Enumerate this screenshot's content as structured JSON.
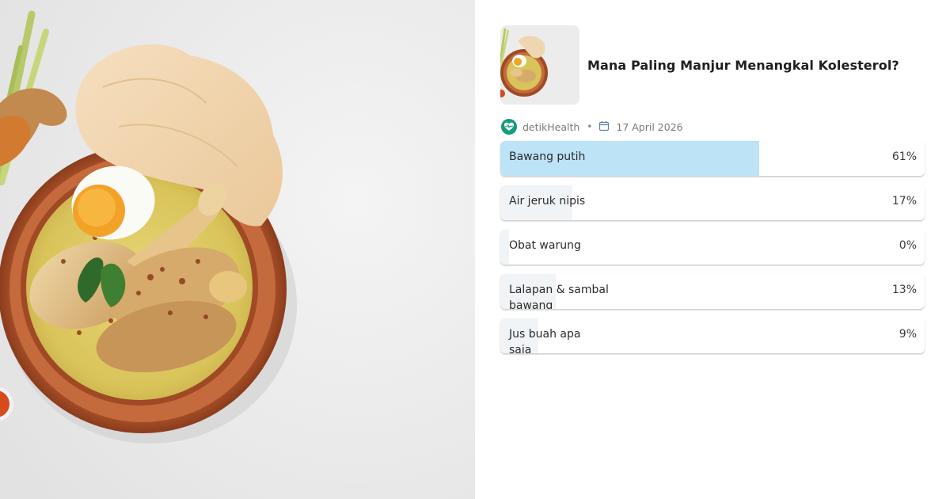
{
  "poll": {
    "title": "Mana Paling Manjur Menangkal Kolesterol?",
    "source": "detikHealth",
    "date": "17 April 2026",
    "icons": {
      "source_logo": "heart-pulse-icon",
      "date": "calendar-icon"
    },
    "accent_color": "#bde3f6",
    "options": [
      {
        "label": "Bawang putih",
        "percent_label": "61%",
        "percent": 61
      },
      {
        "label": "Air jeruk nipis",
        "percent_label": "17%",
        "percent": 17
      },
      {
        "label": "Obat warung",
        "percent_label": "0%",
        "percent": 0
      },
      {
        "label": "Lalapan & sambal bawang",
        "percent_label": "13%",
        "percent": 13
      },
      {
        "label": "Jus buah apa saja",
        "percent_label": "9%",
        "percent": 9
      }
    ]
  }
}
